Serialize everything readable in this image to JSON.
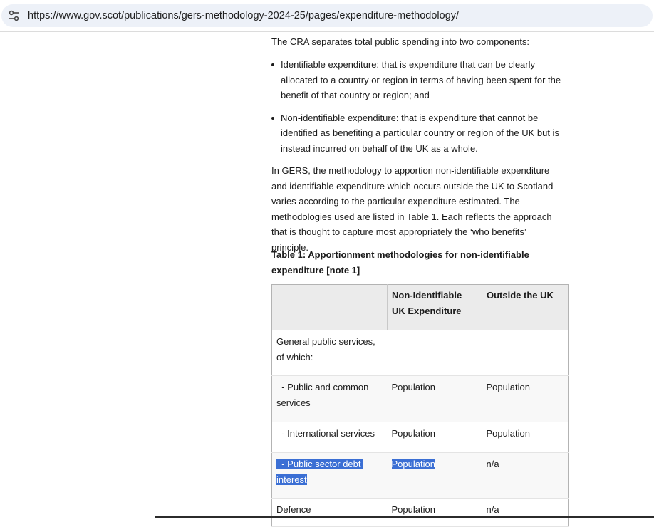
{
  "browser": {
    "url": "https://www.gov.scot/publications/gers-methodology-2024-25/pages/expenditure-methodology/",
    "site_info_icon": "tune-icon"
  },
  "article": {
    "intro": "The CRA separates total public spending into two components:",
    "bullets": [
      "Identifiable expenditure: that is expenditure that can be clearly allocated to a country or region in terms of having been spent for the benefit of that country or region; and",
      "Non-identifiable expenditure: that is expenditure that cannot be identified as benefiting a particular country or region of the UK but is instead incurred on behalf of the UK as a whole."
    ],
    "paragraph": "In GERS, the methodology to apportion non-identifiable expenditure and identifiable expenditure which occurs outside the UK to Scotland varies according to the particular expenditure estimated. The methodologies used are listed in Table 1. Each reflects the approach that is thought to capture most appropriately the ‘who benefits’ principle.",
    "table_caption": "Table 1: Apportionment methodologies for non-identifiable expenditure [note 1]"
  },
  "table": {
    "headers": [
      "",
      "Non-Identifiable UK Expenditure",
      "Outside the UK"
    ],
    "rows": [
      {
        "label": "General public services, of which:",
        "non_identifiable": "",
        "outside_uk": ""
      },
      {
        "label": "  - Public and common services",
        "non_identifiable": "Population",
        "outside_uk": "Population"
      },
      {
        "label": "  - International services",
        "non_identifiable": "Population",
        "outside_uk": "Population"
      },
      {
        "label": "  - Public sector debt interest",
        "non_identifiable": "Population",
        "outside_uk": "n/a"
      },
      {
        "label": "Defence",
        "non_identifiable": "Population",
        "outside_uk": "n/a"
      }
    ]
  },
  "colors": {
    "url_bar_bg": "#edf1f8",
    "table_header_bg": "#ebebeb",
    "selection_highlight": "#3b6fd4"
  }
}
